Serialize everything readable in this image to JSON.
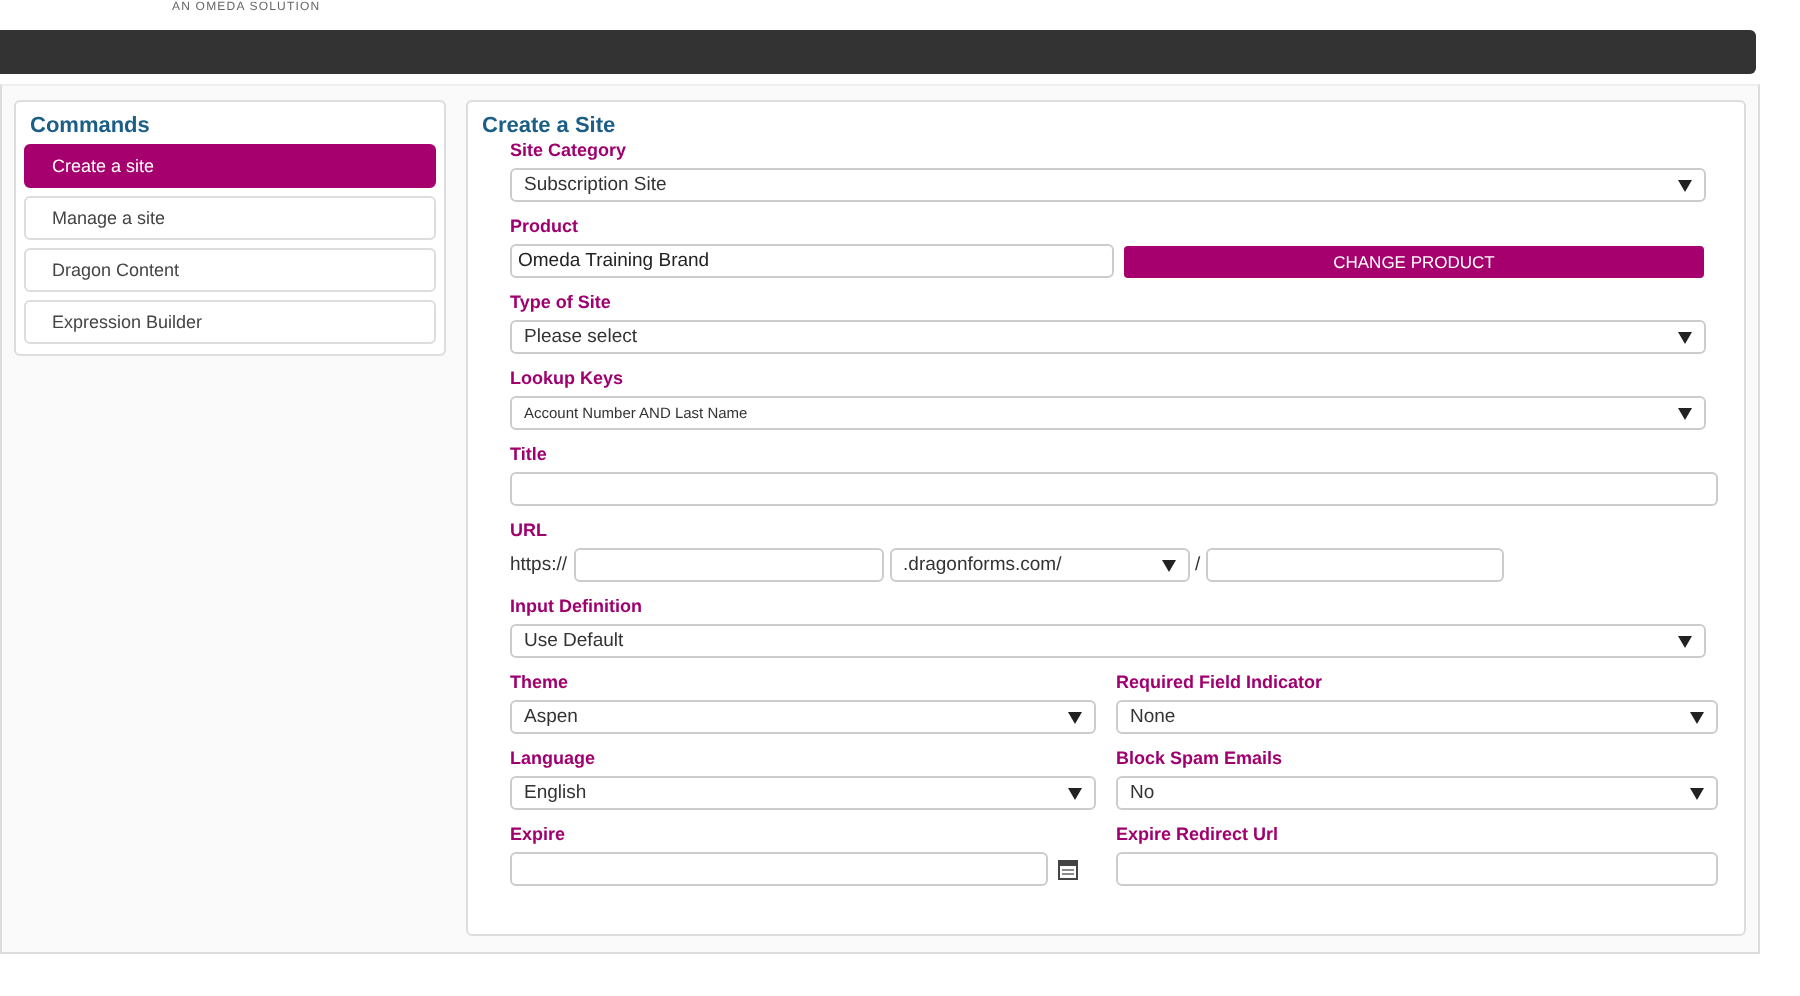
{
  "header": {
    "tagline": "AN OMEDA SOLUTION"
  },
  "sidebar": {
    "title": "Commands",
    "items": [
      {
        "label": "Create a site",
        "selected": true
      },
      {
        "label": "Manage a site",
        "selected": false
      },
      {
        "label": "Dragon Content",
        "selected": false
      },
      {
        "label": "Expression Builder",
        "selected": false
      }
    ]
  },
  "form": {
    "title": "Create a Site",
    "rows": [
      {
        "fields": [
          {
            "kind": "select",
            "label": "Site Category",
            "value": "Subscription Site"
          }
        ]
      },
      {
        "fields": [
          {
            "kind": "product",
            "label": "Product",
            "value": "Omeda Training Brand",
            "button": "CHANGE PRODUCT"
          }
        ]
      },
      {
        "fields": [
          {
            "kind": "select",
            "label": "Type of Site",
            "value": "Please select"
          }
        ]
      },
      {
        "fields": [
          {
            "kind": "small-select",
            "label": "Lookup Keys",
            "value": "Account Number AND Last Name"
          }
        ]
      },
      {
        "fields": [
          {
            "kind": "text",
            "label": "Title"
          }
        ]
      },
      {
        "fields": [
          {
            "kind": "url",
            "label": "URL",
            "prefix": "https://",
            "domain": ".dragonforms.com/",
            "separator": "/"
          }
        ]
      },
      {
        "fields": [
          {
            "kind": "select",
            "label": "Input Definition",
            "value": "Use Default"
          }
        ]
      },
      {
        "fields": [
          {
            "kind": "select",
            "label": "Theme",
            "value": "Aspen"
          },
          {
            "kind": "select",
            "label": "Required Field Indicator",
            "value": "None"
          }
        ]
      },
      {
        "fields": [
          {
            "kind": "select",
            "label": "Language",
            "value": "English"
          },
          {
            "kind": "select",
            "label": "Block Spam Emails",
            "value": "No"
          }
        ]
      },
      {
        "fields": [
          {
            "kind": "date",
            "label": "Expire"
          },
          {
            "kind": "text",
            "label": "Expire Redirect Url"
          }
        ]
      }
    ]
  }
}
